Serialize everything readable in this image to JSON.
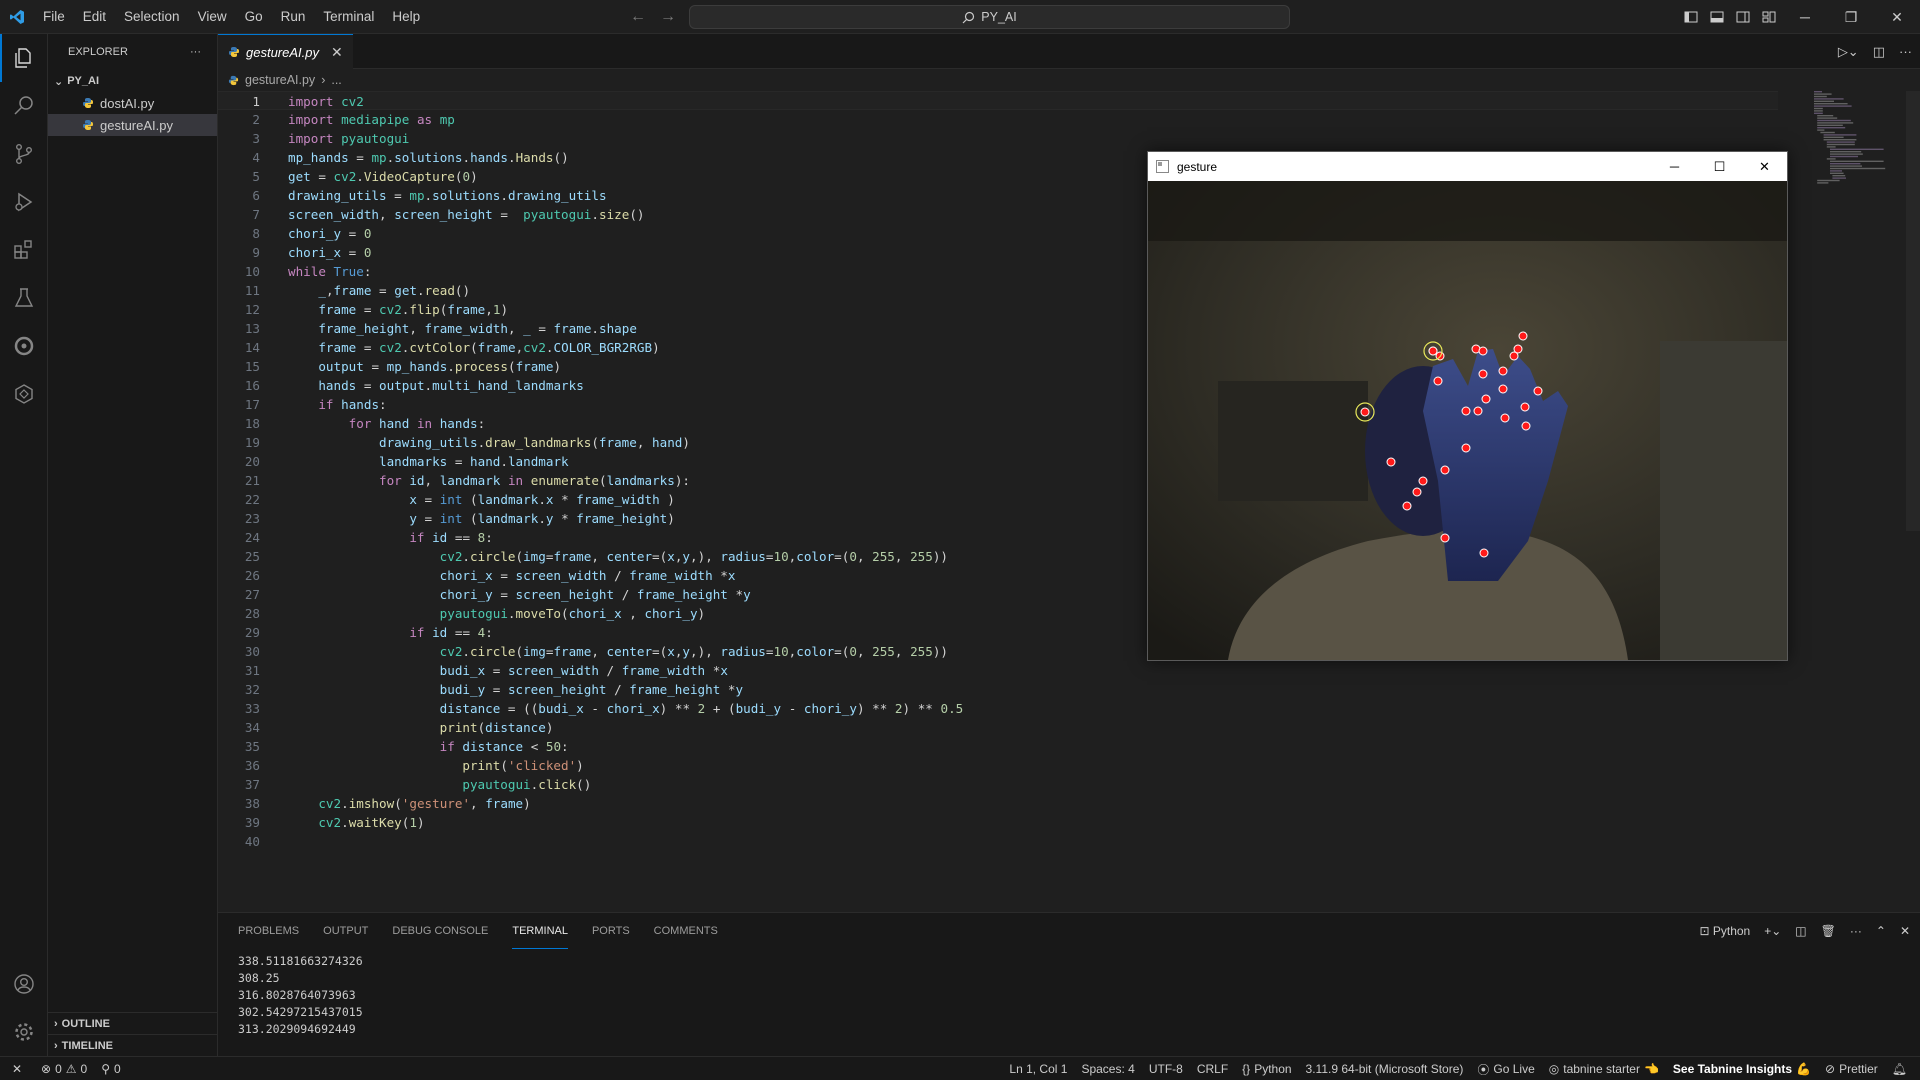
{
  "menu": [
    "File",
    "Edit",
    "Selection",
    "View",
    "Go",
    "Run",
    "Terminal",
    "Help"
  ],
  "search": {
    "text": "PY_AI"
  },
  "sidebar": {
    "title": "EXPLORER",
    "folder": "PY_AI",
    "files": [
      "dostAI.py",
      "gestureAI.py"
    ],
    "outline": "OUTLINE",
    "timeline": "TIMELINE"
  },
  "tab": {
    "label": "gestureAI.py"
  },
  "breadcrumb": {
    "file": "gestureAI.py",
    "rest": "..."
  },
  "code_lines": [
    "import cv2",
    "import mediapipe as mp",
    "import pyautogui",
    "mp_hands = mp.solutions.hands.Hands()",
    "get = cv2.VideoCapture(0)",
    "drawing_utils = mp.solutions.drawing_utils",
    "screen_width, screen_height =  pyautogui.size()",
    "chori_y = 0",
    "chori_x = 0",
    "while True:",
    "    _,frame = get.read()",
    "    frame = cv2.flip(frame,1)",
    "    frame_height, frame_width, _ = frame.shape",
    "    frame = cv2.cvtColor(frame,cv2.COLOR_BGR2RGB)",
    "    output = mp_hands.process(frame)",
    "    hands = output.multi_hand_landmarks",
    "    if hands:",
    "        for hand in hands:",
    "            drawing_utils.draw_landmarks(frame, hand)",
    "            landmarks = hand.landmark",
    "            for id, landmark in enumerate(landmarks):",
    "                x = int (landmark.x * frame_width )",
    "                y = int (landmark.y * frame_height)",
    "                if id == 8:",
    "                    cv2.circle(img=frame, center=(x,y,), radius=10,color=(0, 255, 255))",
    "                    chori_x = screen_width / frame_width *x",
    "                    chori_y = screen_height / frame_height *y",
    "                    pyautogui.moveTo(chori_x , chori_y)",
    "                if id == 4:",
    "                    cv2.circle(img=frame, center=(x,y,), radius=10,color=(0, 255, 255))",
    "                    budi_x = screen_width / frame_width *x",
    "                    budi_y = screen_height / frame_height *y",
    "                    distance = ((budi_x - chori_x) ** 2 + (budi_y - chori_y) ** 2) ** 0.5",
    "                    print(distance)",
    "                    if distance < 50:",
    "                       print('clicked')",
    "                       pyautogui.click()",
    "    cv2.imshow('gesture', frame)",
    "    cv2.waitKey(1)",
    ""
  ],
  "gesture_window": {
    "title": "gesture"
  },
  "panel": {
    "tabs": [
      "PROBLEMS",
      "OUTPUT",
      "DEBUG CONSOLE",
      "TERMINAL",
      "PORTS",
      "COMMENTS"
    ],
    "active_tab": "TERMINAL",
    "terminal_profile": "Python",
    "terminal_lines": [
      "338.51181663274326",
      "308.25",
      "316.8028764073963",
      "302.54297215437015",
      "313.2029094692449"
    ]
  },
  "status": {
    "errors": "0",
    "warnings": "0",
    "ports": "0",
    "position": "Ln 1, Col 1",
    "spaces": "Spaces: 4",
    "encoding": "UTF-8",
    "eol": "CRLF",
    "language": "Python",
    "interpreter": "3.11.9 64-bit (Microsoft Store)",
    "golive": "Go Live",
    "tabnine": "tabnine starter",
    "tabnine_insights": "See Tabnine Insights",
    "prettier": "Prettier"
  },
  "colors": {
    "accent": "#0078d4",
    "keyword": "#c586c0",
    "builtin": "#569cd6",
    "function": "#dcdcaa",
    "number": "#b5cea8",
    "string": "#ce9178"
  }
}
